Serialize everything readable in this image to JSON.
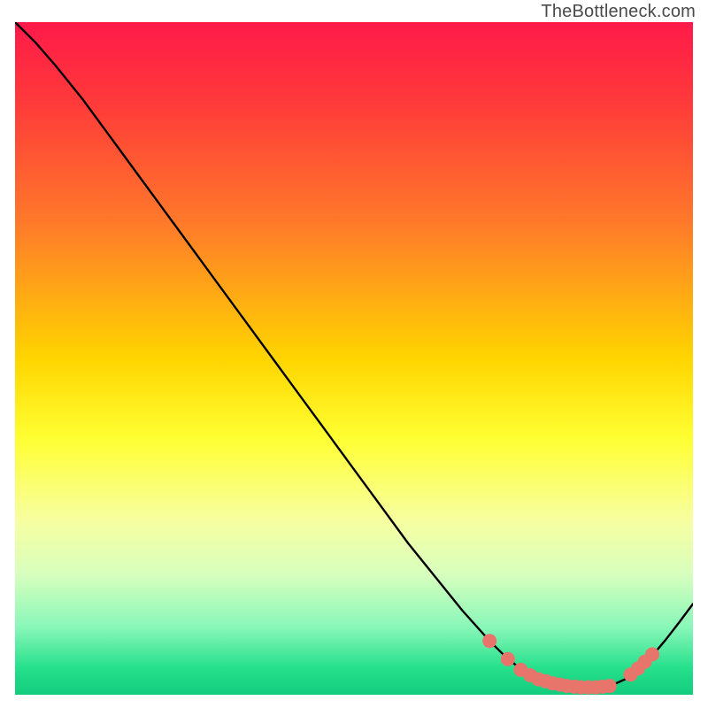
{
  "watermark": "TheBottleneck.com",
  "chart_data": {
    "type": "line",
    "title": "",
    "xlabel": "",
    "ylabel": "",
    "xlim": [
      0,
      100
    ],
    "ylim": [
      0,
      100
    ],
    "grid": false,
    "legend": false,
    "gradient_stops": [
      {
        "offset": 0,
        "color": "#ff1a4a"
      },
      {
        "offset": 12,
        "color": "#ff3a3a"
      },
      {
        "offset": 30,
        "color": "#ff7a2a"
      },
      {
        "offset": 50,
        "color": "#ffd500"
      },
      {
        "offset": 62,
        "color": "#ffff33"
      },
      {
        "offset": 74,
        "color": "#f7ffa0"
      },
      {
        "offset": 82,
        "color": "#d8ffbe"
      },
      {
        "offset": 90,
        "color": "#88f7b8"
      },
      {
        "offset": 96,
        "color": "#26e08c"
      },
      {
        "offset": 100,
        "color": "#13cc7e"
      }
    ],
    "series": [
      {
        "name": "curve",
        "color": "#000000",
        "x": [
          0,
          3,
          6,
          10,
          14,
          18,
          22,
          26,
          30,
          34,
          38,
          42,
          46,
          50,
          54,
          58,
          62,
          66,
          70,
          72,
          74,
          76,
          78,
          80,
          82,
          84,
          86,
          88,
          90,
          92,
          94,
          96,
          98,
          100
        ],
        "y": [
          100,
          97,
          93.5,
          88.5,
          83,
          77.5,
          72,
          66.5,
          61,
          55.5,
          50,
          44.5,
          39,
          33.5,
          28,
          22.5,
          17.5,
          12.5,
          8,
          6,
          4.3,
          3.1,
          2.3,
          1.7,
          1.3,
          1.1,
          1.1,
          1.4,
          2.3,
          3.8,
          5.8,
          8.2,
          10.8,
          13.5
        ]
      }
    ],
    "markers": {
      "name": "dots",
      "color": "#e8756b",
      "radius_px": 8,
      "points": [
        {
          "x": 70,
          "y": 8.0
        },
        {
          "x": 72.7,
          "y": 5.3
        },
        {
          "x": 74.6,
          "y": 3.7
        },
        {
          "x": 76.0,
          "y": 2.9
        },
        {
          "x": 77.2,
          "y": 2.3
        },
        {
          "x": 78.3,
          "y": 2.0
        },
        {
          "x": 79.3,
          "y": 1.7
        },
        {
          "x": 80.4,
          "y": 1.5
        },
        {
          "x": 81.4,
          "y": 1.3
        },
        {
          "x": 82.5,
          "y": 1.2
        },
        {
          "x": 83.5,
          "y": 1.1
        },
        {
          "x": 84.6,
          "y": 1.1
        },
        {
          "x": 85.7,
          "y": 1.1
        },
        {
          "x": 86.7,
          "y": 1.2
        },
        {
          "x": 87.7,
          "y": 1.3
        },
        {
          "x": 90.8,
          "y": 3.0
        },
        {
          "x": 91.9,
          "y": 3.9
        },
        {
          "x": 92.9,
          "y": 4.9
        },
        {
          "x": 94.0,
          "y": 6.0
        }
      ]
    }
  }
}
